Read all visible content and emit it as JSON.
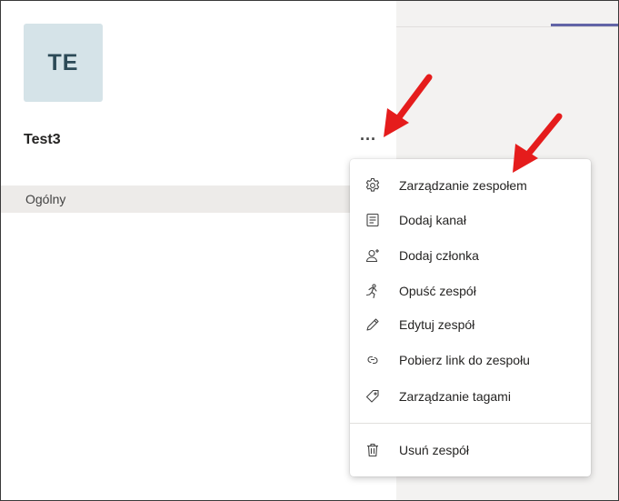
{
  "team": {
    "avatar_initials": "TE",
    "name": "Test3",
    "more_options_label": "···"
  },
  "channels": [
    {
      "label": "Ogólny"
    }
  ],
  "context_menu": {
    "items": [
      {
        "label": "Zarządzanie zespołem",
        "icon": "gear-icon"
      },
      {
        "label": "Dodaj kanał",
        "icon": "channel-list-icon"
      },
      {
        "label": "Dodaj członka",
        "icon": "add-person-icon"
      },
      {
        "label": "Opuść zespół",
        "icon": "leave-running-icon"
      },
      {
        "label": "Edytuj zespół",
        "icon": "pencil-icon"
      },
      {
        "label": "Pobierz link do zespołu",
        "icon": "link-icon"
      },
      {
        "label": "Zarządzanie tagami",
        "icon": "tag-icon"
      }
    ],
    "footer_items": [
      {
        "label": "Usuń zespół",
        "icon": "trash-icon"
      }
    ]
  },
  "colors": {
    "accent": "#6264a7",
    "annotation_arrow": "#e51c1c",
    "avatar_bg": "#d5e3e8",
    "selected_row_bg": "#edebe9"
  }
}
